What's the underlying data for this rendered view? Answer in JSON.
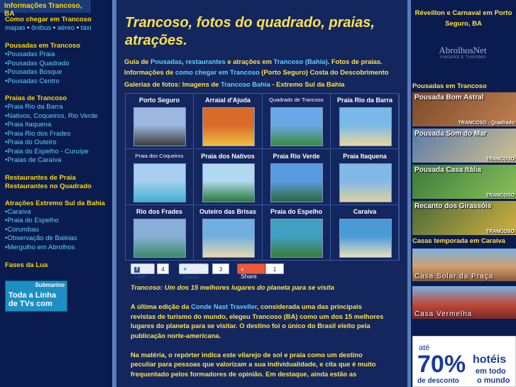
{
  "left": {
    "header": "Informações Trancoso, BA",
    "sections": [
      {
        "title": "Como chegar em Trancoso",
        "inline": [
          "mapas",
          "ônibus",
          "aéreo",
          "táxi"
        ]
      },
      {
        "title": "Pousadas em Trancoso",
        "items": [
          "Pousadas Praia",
          "Pousadas Quadrado",
          "Pousadas Bosque",
          "Pousadas Centro"
        ]
      },
      {
        "title": "Praias de Trancoso",
        "items": [
          "Praia Rio da Barra",
          "Nativos, Coqueiros, Rio Verde",
          "Praia Itaquena",
          "Praia Rio dos Frades",
          "Praia do Outeiro",
          "Praia do Espelho - Curuípe",
          "Praias de Caraíva"
        ]
      },
      {
        "title": "Restaurantes de Praia",
        "title2": "Restaurantes no Quadrado"
      },
      {
        "title": "Atrações Extremo Sul da Bahia",
        "items": [
          "Caraíva",
          "Praia do Espelho",
          "Corumbau",
          "Observação de Baleias",
          "Mergulho em Abrolhos"
        ]
      },
      {
        "title": "Fases da Lua"
      }
    ],
    "ad": {
      "brand": "Submarino",
      "text": "Toda a Linha de TVs com"
    }
  },
  "main": {
    "title": "Trancoso, fotos do quadrado, praias, atrações.",
    "intro": {
      "p1": "Guia de ",
      "l1": "Pousadas",
      "p2": ", ",
      "l2": "restaurantes",
      "p3": " e atrações em ",
      "l3": "Trancoso (Bahia)",
      "p4": ". Fotos de praias. Informações de ",
      "l4": "como chegar em Trancoso",
      "p5": " (Porto Seguro) Costa do Descobrimento"
    },
    "gallery_title": {
      "p1": "Galerias de fotos: Imagens de ",
      "l1": "Trancoso Bahia",
      "p2": " - Extremo Sul da Bahia"
    },
    "gallery": [
      {
        "label": "Porto Seguro",
        "small": false,
        "colors": [
          "#9ab8e0",
          "#3c3c3c"
        ]
      },
      {
        "label": "Arraial d'Ajuda",
        "small": false,
        "colors": [
          "#d86a2a",
          "#f0c040"
        ]
      },
      {
        "label": "Quadrado de Trancoso",
        "small": true,
        "colors": [
          "#6aa8e8",
          "#3a8a3a"
        ]
      },
      {
        "label": "Praia Rio da Barra",
        "small": false,
        "colors": [
          "#7ab8e8",
          "#e8d8a0"
        ]
      },
      {
        "label": "Praia dos Coqueiros",
        "small": true,
        "colors": [
          "#a8d0f0",
          "#40b0d0"
        ]
      },
      {
        "label": "Praia dos Nativos",
        "small": false,
        "colors": [
          "#b0d8f0",
          "#2a7a3a"
        ]
      },
      {
        "label": "Praia Rio Verde",
        "small": false,
        "colors": [
          "#5a9ae0",
          "#2a6a3a"
        ]
      },
      {
        "label": "Praia Itaquena",
        "small": false,
        "colors": [
          "#80b8e8",
          "#e0d0a0"
        ]
      },
      {
        "label": "Rio dos Frades",
        "small": false,
        "colors": [
          "#8ab0d8",
          "#3a8a6a"
        ]
      },
      {
        "label": "Outeiro das Brisas",
        "small": false,
        "colors": [
          "#70b0e0",
          "#e8d8b0"
        ]
      },
      {
        "label": "Praia do Espelho",
        "small": false,
        "colors": [
          "#40a0c0",
          "#3a7a3a"
        ]
      },
      {
        "label": "Caraíva",
        "small": false,
        "colors": [
          "#4a9ad8",
          "#e8e0c0"
        ]
      }
    ],
    "social": {
      "like": "Like",
      "like_count": "4",
      "tweet": "Tweet",
      "tweet_count": "3",
      "share": "Share",
      "share_count": "1"
    },
    "article": {
      "heading": "Trancoso: Um dos 15 melhores lugares do planeta para se visita",
      "p1a": "A última edição da ",
      "p1link": "Conde Nast Traveller",
      "p1b": ", considerada uma das principais revistas de turismo do mundo, elegeu Trancoso (BA) como um dos 15 melhores lugares do planeta para se visitar. O destino foi o único do Brasil eleito pela publicação norte-americana.",
      "p2": "Na matéria, o repórter indica este vilarejo de sol e praia como um destino peculiar para pessoas que valorizam a sua individualidade, e cita que é muito frequentado pelos formadores de opinião. Em destaque, ainda estão as"
    }
  },
  "right": {
    "top": "Réveillon e Carnaval em Porto Seguro, BA",
    "logo": {
      "name": "AbrolhosNet",
      "tag": "VIAGENS E TURISMO"
    },
    "pousadas_title": "Pousadas em Trancoso",
    "pousadas": [
      {
        "name": "Pousada Bom Astral",
        "badge": "TRANCOSO - Quadrado",
        "colors": [
          "#7a4a2a",
          "#c08050"
        ]
      },
      {
        "name": "Pousada Som do Mar",
        "badge": "TRANCOSO",
        "colors": [
          "#5a7aaa",
          "#d0c090"
        ]
      },
      {
        "name": "Pousada Casa Itália",
        "badge": "TRANCOSO",
        "colors": [
          "#3a7a3a",
          "#8ac05a"
        ]
      },
      {
        "name": "Recanto dos Girassóis",
        "badge": "TRANCOSO",
        "colors": [
          "#4a6a3a",
          "#d0b040"
        ]
      }
    ],
    "casas_title": "Casas temporada em Caraíva",
    "casas": [
      {
        "name": "Casa Solar da Praça",
        "colors": [
          "#8a5a3a",
          "#d0a070"
        ]
      },
      {
        "name": "Casa Vermelha",
        "colors": [
          "#7a2a2a",
          "#c04a3a"
        ]
      }
    ],
    "ad": {
      "pre": "até",
      "pct": "70%",
      "desc": "de desconto",
      "h1": "hotéis",
      "h2": "em todo",
      "h3": "o mundo"
    }
  }
}
